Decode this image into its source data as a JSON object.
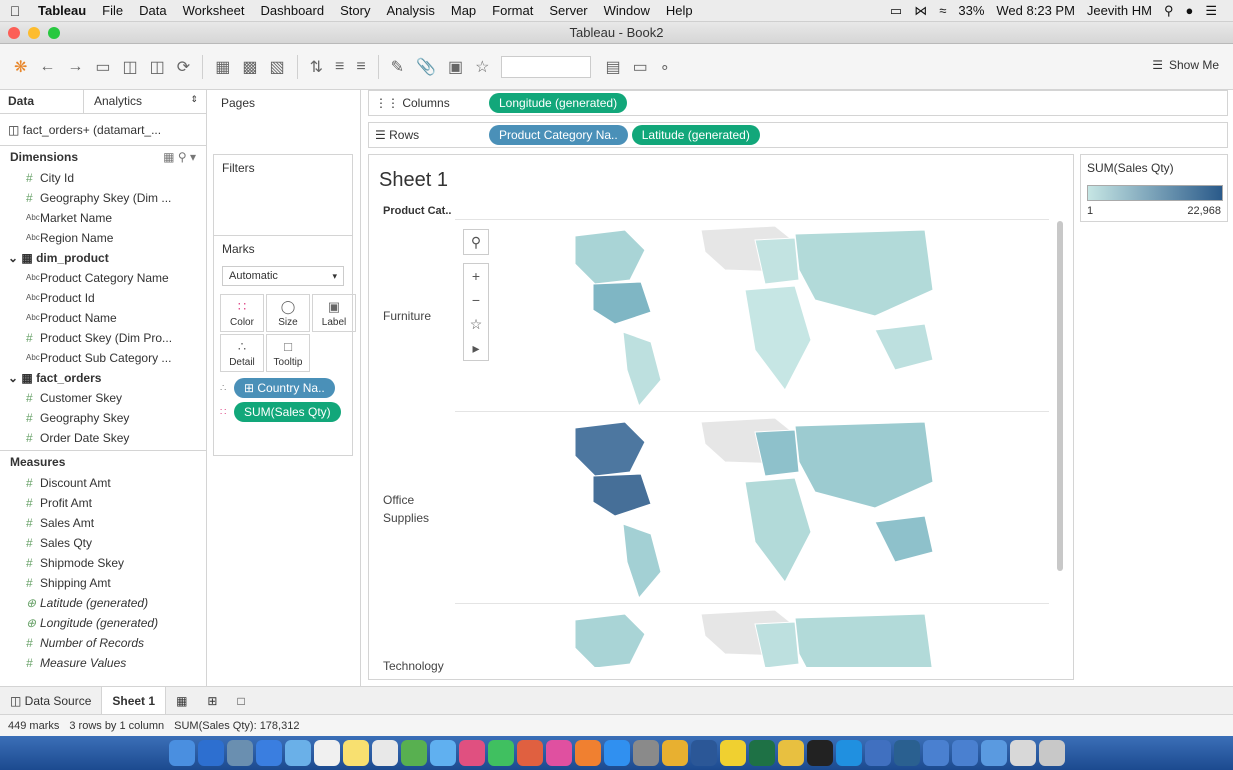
{
  "menubar": {
    "app": "Tableau",
    "items": [
      "File",
      "Data",
      "Worksheet",
      "Dashboard",
      "Story",
      "Analysis",
      "Map",
      "Format",
      "Server",
      "Window",
      "Help"
    ],
    "battery": "33%",
    "clock": "Wed 8:23 PM",
    "user": "Jeevith HM"
  },
  "window": {
    "title": "Tableau - Book2"
  },
  "toolbar": {
    "show_me": "Show Me"
  },
  "left": {
    "tab_data": "Data",
    "tab_analytics": "Analytics",
    "datasource": "fact_orders+ (datamart_...",
    "dimensions_label": "Dimensions",
    "dim_fields": [
      {
        "name": "City Id",
        "type": "num"
      },
      {
        "name": "Geography Skey (Dim ...",
        "type": "num"
      },
      {
        "name": "Market Name",
        "type": "abc"
      },
      {
        "name": "Region Name",
        "type": "abc"
      }
    ],
    "folder_product": "dim_product",
    "product_fields": [
      {
        "name": "Product Category Name",
        "type": "abc"
      },
      {
        "name": "Product Id",
        "type": "abc"
      },
      {
        "name": "Product Name",
        "type": "abc"
      },
      {
        "name": "Product Skey (Dim Pro...",
        "type": "num"
      },
      {
        "name": "Product Sub Category ...",
        "type": "abc"
      }
    ],
    "folder_orders": "fact_orders",
    "order_fields": [
      {
        "name": "Customer Skey",
        "type": "num"
      },
      {
        "name": "Geography Skey",
        "type": "num"
      },
      {
        "name": "Order Date Skey",
        "type": "num"
      }
    ],
    "measures_label": "Measures",
    "measure_fields": [
      {
        "name": "Discount Amt",
        "type": "num"
      },
      {
        "name": "Profit Amt",
        "type": "num"
      },
      {
        "name": "Sales Amt",
        "type": "num"
      },
      {
        "name": "Sales Qty",
        "type": "num"
      },
      {
        "name": "Shipmode Skey",
        "type": "num"
      },
      {
        "name": "Shipping Amt",
        "type": "num"
      },
      {
        "name": "Latitude (generated)",
        "type": "geo"
      },
      {
        "name": "Longitude (generated)",
        "type": "geo"
      },
      {
        "name": "Number of Records",
        "type": "num"
      },
      {
        "name": "Measure Values",
        "type": "num"
      }
    ]
  },
  "cards": {
    "pages": "Pages",
    "filters": "Filters",
    "marks": "Marks",
    "mark_type": "Automatic",
    "buttons": [
      "Color",
      "Size",
      "Label",
      "Detail",
      "Tooltip"
    ],
    "pill_country": "Country Na..",
    "pill_sales": "SUM(Sales Qty)"
  },
  "shelves": {
    "columns_label": "Columns",
    "columns_pill": "Longitude (generated)",
    "rows_label": "Rows",
    "rows_pill_1": "Product Category Na..",
    "rows_pill_2": "Latitude (generated)"
  },
  "view": {
    "title": "Sheet 1",
    "header": "Product Cat..",
    "rows": [
      "Furniture",
      "Office Supplies",
      "Technology"
    ]
  },
  "legend": {
    "title": "SUM(Sales Qty)",
    "min": "1",
    "max": "22,968",
    "color_low": "#c6e6e4",
    "color_high": "#2a5a8a"
  },
  "tabs": {
    "data_source": "Data Source",
    "sheet1": "Sheet 1"
  },
  "status": {
    "marks": "449 marks",
    "dims": "3 rows by 1 column",
    "sum": "SUM(Sales Qty): 178,312"
  }
}
